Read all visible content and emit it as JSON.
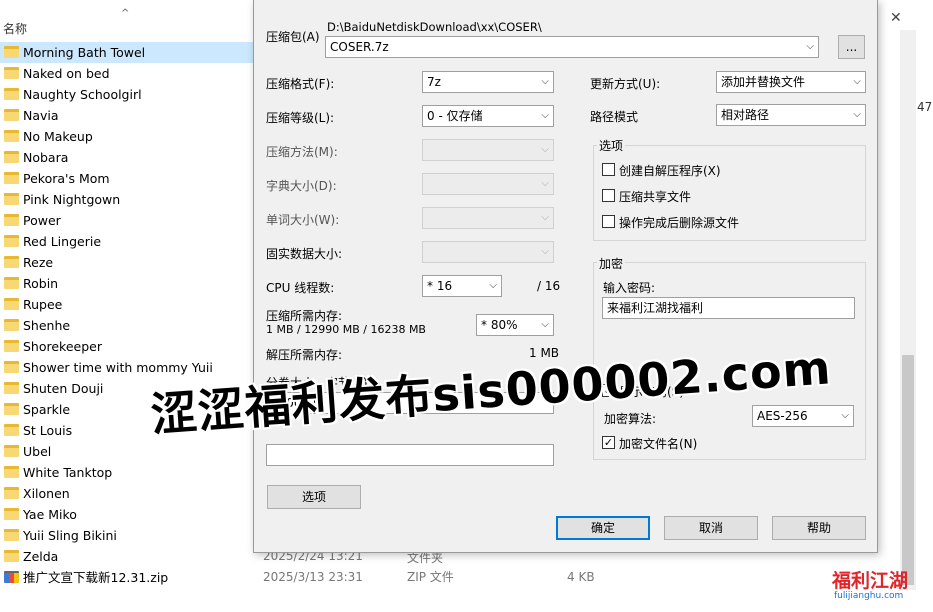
{
  "explorer": {
    "column_name": "名称",
    "files": [
      {
        "name": "Morning Bath Towel",
        "selected": true
      },
      {
        "name": "Naked on bed"
      },
      {
        "name": "Naughty Schoolgirl"
      },
      {
        "name": "Navia"
      },
      {
        "name": "No Makeup"
      },
      {
        "name": "Nobara"
      },
      {
        "name": "Pekora's Mom"
      },
      {
        "name": "Pink Nightgown"
      },
      {
        "name": "Power"
      },
      {
        "name": "Red Lingerie"
      },
      {
        "name": "Reze"
      },
      {
        "name": "Robin"
      },
      {
        "name": "Rupee"
      },
      {
        "name": "Shenhe"
      },
      {
        "name": "Shorekeeper"
      },
      {
        "name": "Shower time with mommy Yuii"
      },
      {
        "name": "Shuten Douji"
      },
      {
        "name": "Sparkle"
      },
      {
        "name": "St Louis"
      },
      {
        "name": "Ubel"
      },
      {
        "name": "White Tanktop"
      },
      {
        "name": "Xilonen"
      },
      {
        "name": "Yae Miko"
      },
      {
        "name": "Yuii Sling Bikini"
      },
      {
        "name": "Zelda"
      }
    ],
    "zelda_date": "2025/2/24 13:21",
    "zelda_type": "文件夹",
    "zip_file": {
      "name": "推广文宣下载新12.31.zip",
      "date": "2025/3/13 23:31",
      "type": "ZIP 文件",
      "size": "4 KB"
    },
    "right_clip": "47"
  },
  "dialog": {
    "archive_label": "压缩包(A)",
    "archive_path": "D:\\BaiduNetdiskDownload\\xx\\COSER\\",
    "archive_name": "COSER.7z",
    "browse_label": "...",
    "format_label": "压缩格式(F):",
    "format_value": "7z",
    "level_label": "压缩等级(L):",
    "level_value": "0 - 仅存储",
    "method_label": "压缩方法(M):",
    "dict_label": "字典大小(D):",
    "word_label": "单词大小(W):",
    "solid_label": "固实数据大小:",
    "cpu_label": "CPU 线程数:",
    "cpu_value": "* 16",
    "cpu_total": "/ 16",
    "mem_compress_label": "压缩所需内存:",
    "mem_compress_value": "1 MB / 12990 MB / 16238 MB",
    "mem_percent": "* 80%",
    "mem_decompress_label": "解压所需内存:",
    "mem_decompress_value": "1 MB",
    "split_label": "分卷大小，字节(V):",
    "split_value": "4000m",
    "options_button": "选项",
    "update_label": "更新方式(U):",
    "update_value": "添加并替换文件",
    "path_label": "路径模式",
    "path_value": "相对路径",
    "options_group": "选项",
    "opt_sfx": "创建自解压程序(X)",
    "opt_shared": "压缩共享文件",
    "opt_delete": "操作完成后删除源文件",
    "encrypt_group": "加密",
    "pwd_label": "输入密码:",
    "pwd_value": "来福利江湖找福利",
    "show_pwd_label": "显示密码(S)",
    "enc_method_label": "加密算法:",
    "enc_method_value": "AES-256",
    "enc_names_label": "加密文件名(N)",
    "ok": "确定",
    "cancel": "取消",
    "help": "帮助"
  },
  "overlay": {
    "watermark": "涩涩福利发布sis000002.com",
    "logo_main": "福利江湖",
    "logo_url": "fulijianghu.com"
  }
}
